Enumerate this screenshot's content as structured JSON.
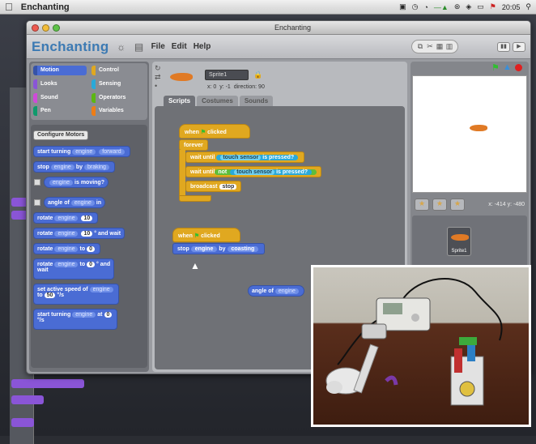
{
  "menubar": {
    "app_name": "Enchanting",
    "time": "20:05"
  },
  "window": {
    "title": "Enchanting"
  },
  "topbar": {
    "logo": "Enchanting",
    "menus": [
      "File",
      "Edit",
      "Help"
    ]
  },
  "categories": [
    {
      "label": "Motion",
      "color": "#4a6cd4"
    },
    {
      "label": "Control",
      "color": "#e0a820"
    },
    {
      "label": "Looks",
      "color": "#8a55d7"
    },
    {
      "label": "Sensing",
      "color": "#2aa9d9"
    },
    {
      "label": "Sound",
      "color": "#cf4ad9"
    },
    {
      "label": "Operators",
      "color": "#5cb712"
    },
    {
      "label": "Pen",
      "color": "#0e9a6c"
    },
    {
      "label": "Variables",
      "color": "#ee7d16"
    }
  ],
  "palette": {
    "config_button": "Configure Motors",
    "start_turning": {
      "a": "start turning",
      "slot": "engine",
      "b": "forward"
    },
    "stop": {
      "a": "stop",
      "slot": "engine",
      "b": "by",
      "c": "braking"
    },
    "is_moving": {
      "slot": "engine",
      "b": "is moving?"
    },
    "angle_of": {
      "a": "angle of",
      "slot": "engine",
      "b": "in"
    },
    "rotate": {
      "a": "rotate",
      "slot": "engine",
      "num": "10"
    },
    "rotate_wait": {
      "a": "rotate",
      "slot": "engine",
      "num": "10",
      "b": "° and wait"
    },
    "rotate_to": {
      "a": "rotate",
      "slot": "engine",
      "b": "to",
      "num": "0"
    },
    "rotate_to_and": {
      "a": "rotate",
      "slot": "engine",
      "b": "to",
      "num": "0",
      "c": "° and",
      "d": "wait"
    },
    "set_speed": {
      "a": "set active speed of",
      "slot": "engine",
      "b": "to",
      "num": "50",
      "c": "°/s"
    },
    "start_turning_at": {
      "a": "start turning",
      "slot": "engine",
      "b": "at",
      "num": "0",
      "c": "°/s"
    }
  },
  "sprite": {
    "name": "Sprite1",
    "x": "x: 0",
    "y": "y: -1",
    "direction": "direction: 90"
  },
  "tabs": [
    "Scripts",
    "Costumes",
    "Sounds"
  ],
  "script1": {
    "hat": "when",
    "hat2": "clicked",
    "forever": "forever",
    "wait1": "wait until",
    "touch1": "touch sensor",
    "pressed": "is pressed?",
    "wait2": "wait until",
    "not": "not",
    "touch2": "touch sensor",
    "broadcast": "broadcast",
    "msg": "stop"
  },
  "script2": {
    "hat": "when",
    "hat2": "clicked",
    "stop": "stop",
    "slot": "engine",
    "by": "by",
    "coast": "coasting"
  },
  "loose_block": {
    "a": "angle of",
    "slot": "engine"
  },
  "stage": {
    "mouse": "x: -414  y: -480"
  },
  "spritelist": {
    "thumb": "Sprite1"
  }
}
